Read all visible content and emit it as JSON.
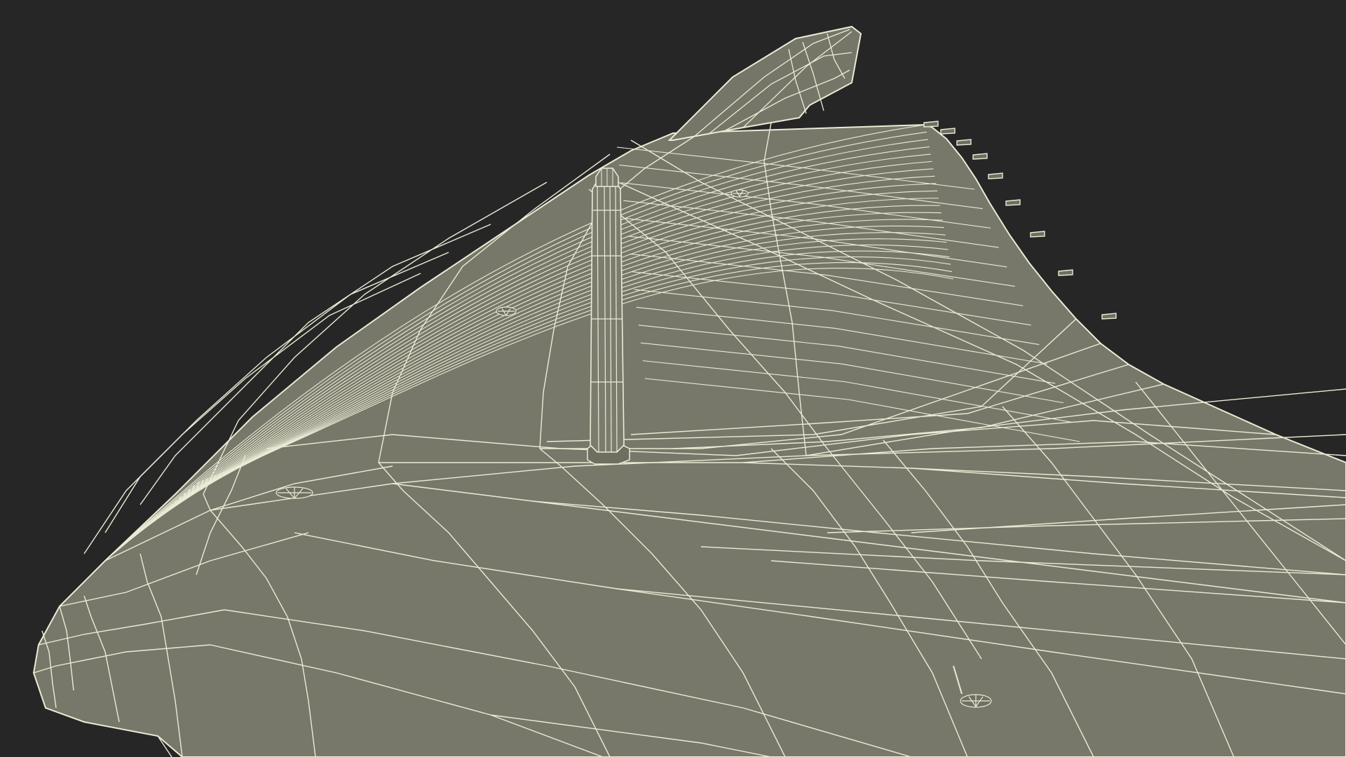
{
  "scene": {
    "background_color": "#262626",
    "surface_color": "#777869",
    "surface_shade_color": "#6f7062",
    "wire_color": "#ecebd6",
    "mast_color": "#7b7c6e",
    "render_style": "wireframe-on-shaded"
  }
}
